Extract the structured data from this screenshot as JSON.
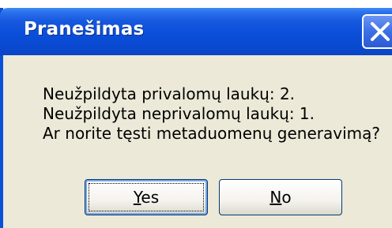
{
  "dialog": {
    "title": "Pranešimas",
    "close_icon": "close-icon",
    "message_lines": [
      "Neužpildyta privalomų laukų: 2.",
      "Neužpildyta neprivalomų laukų: 1.",
      "Ar norite tęsti metaduomenų generavimą?"
    ],
    "buttons": {
      "yes_mnemonic": "Y",
      "yes_rest": "es",
      "no_mnemonic": "N",
      "no_rest": "o"
    }
  },
  "colors": {
    "titlebar": "#0b4ed8",
    "dialog_bg": "#ece9d8",
    "button_border": "#003c74"
  }
}
